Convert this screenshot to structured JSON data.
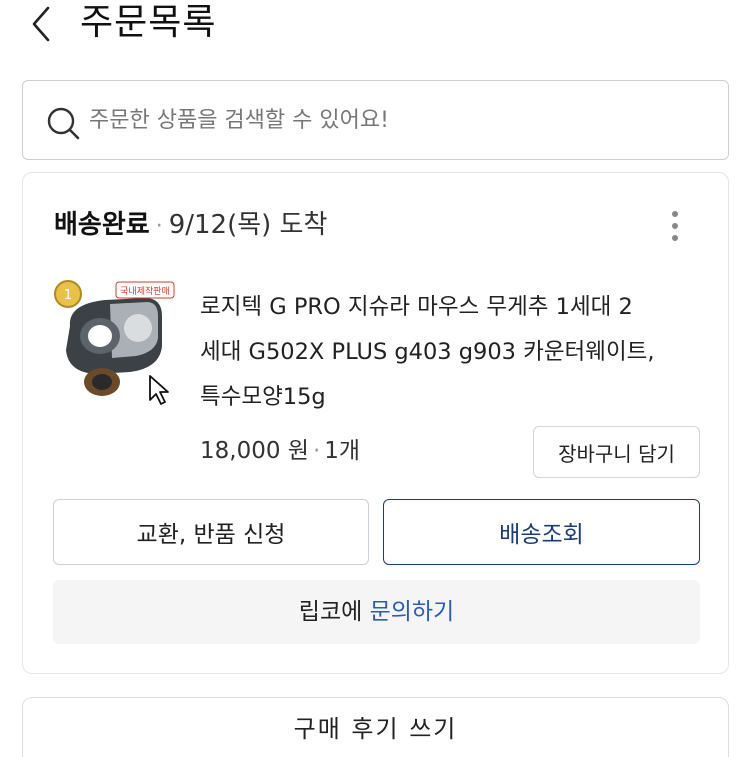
{
  "header": {
    "title": "주문목록",
    "back_icon": "chevron-left-icon"
  },
  "search": {
    "placeholder": "주문한 상품을 검색할 수 있어요!",
    "value": "",
    "icon": "search-icon"
  },
  "order": {
    "status": "배송완료",
    "separator": "·",
    "arrival": "9/12(목) 도착",
    "more_icon": "more-vertical-icon",
    "product": {
      "name_line1": "로지텍 G PRO 지슈라 마우스 무게추 1세대 2",
      "name_line2": "세대 G502X PLUS g403 g903 카운터웨이트,",
      "name_line3": "특수모양15g",
      "price": "18,000 원",
      "quantity": "1개",
      "thumbnail_label": "국내제작판매",
      "thumbnail_badge": "1"
    },
    "buttons": {
      "cart": "장바구니 담기",
      "exchange_return": "교환, 반품 신청",
      "tracking": "배송조회"
    },
    "inquiry": {
      "seller": "립코에",
      "link": "문의하기"
    }
  },
  "review": {
    "label": "구매 후기 쓰기"
  },
  "colors": {
    "accent_navy": "#1a3c7a",
    "link_blue": "#2a5cb8",
    "border": "#cfcfcf",
    "inquiry_bg": "#f5f5f6"
  }
}
